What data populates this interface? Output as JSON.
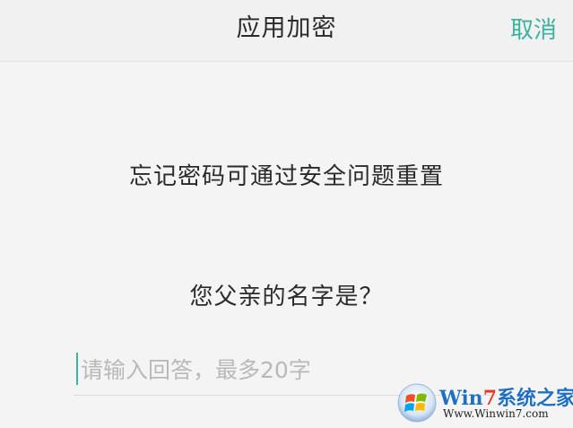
{
  "header": {
    "title": "应用加密",
    "cancel_label": "取消"
  },
  "main": {
    "hint_text": "忘记密码可通过安全问题重置",
    "question_text": "您父亲的名字是？",
    "answer": {
      "value": "",
      "placeholder": "请输入回答，最多20字"
    }
  },
  "watermark": {
    "brand_prefix": "Win",
    "brand_seven": "7",
    "brand_suffix": "系统之家",
    "url": "Www.Winwin7.com"
  },
  "colors": {
    "accent": "#3cb39e",
    "background": "#f4f4f4",
    "text": "#2a2a2a",
    "placeholder": "#b9b9b9"
  },
  "icons": {
    "watermark_logo": "windows-logo-icon"
  }
}
